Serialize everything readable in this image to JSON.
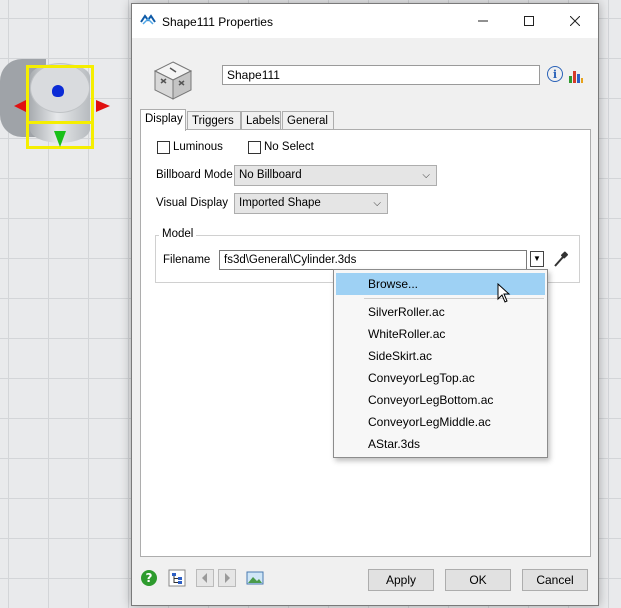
{
  "window": {
    "title": "Shape111 Properties",
    "object_name": "Shape111"
  },
  "tabs": [
    {
      "label": "Display",
      "active": true
    },
    {
      "label": "Triggers",
      "active": false
    },
    {
      "label": "Labels",
      "active": false
    },
    {
      "label": "General",
      "active": false
    }
  ],
  "display": {
    "luminous_label": "Luminous",
    "luminous_checked": false,
    "noselect_label": "No Select",
    "noselect_checked": false,
    "billboard_label": "Billboard Mode",
    "billboard_value": "No Billboard",
    "visual_label": "Visual Display",
    "visual_value": "Imported Shape",
    "model_group": "Model",
    "filename_label": "Filename",
    "filename_value": "fs3d\\General\\Cylinder.3ds"
  },
  "dropdown": {
    "highlighted": "Browse...",
    "items": [
      "Browse...",
      "SilverRoller.ac",
      "WhiteRoller.ac",
      "SideSkirt.ac",
      "ConveyorLegTop.ac",
      "ConveyorLegBottom.ac",
      "ConveyorLegMiddle.ac",
      "AStar.3ds"
    ]
  },
  "buttons": {
    "apply": "Apply",
    "ok": "OK",
    "cancel": "Cancel"
  },
  "icons": {
    "app": "flexsim-logo-icon",
    "object": "cube-shape-icon",
    "info": "info-icon",
    "stats": "statistics-chart-icon",
    "eyedropper": "eyedropper-icon",
    "help": "help-icon",
    "tree": "tree-view-icon",
    "prev": "previous-arrow-icon",
    "next": "next-arrow-icon",
    "image": "image-icon"
  },
  "colors": {
    "highlight": "#9ed1f4",
    "selection_box": "#f5ee00",
    "axis_x": "#e01010",
    "axis_y": "#19c019",
    "axis_z": "#0b2bd6"
  }
}
